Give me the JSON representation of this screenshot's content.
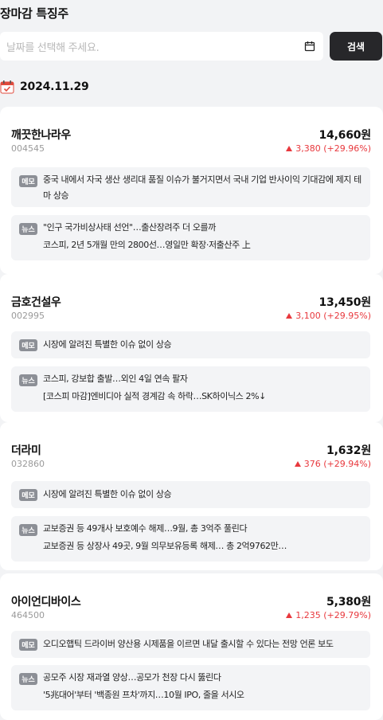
{
  "page": {
    "title": "장마감 특징주"
  },
  "search": {
    "placeholder": "날짜를 선택해 주세요.",
    "button_label": "검색"
  },
  "date_label": "2024.11.29",
  "colors": {
    "accent_up": "#e8383d",
    "button_bg": "#27272a",
    "tag_bg": "#8c8f96"
  },
  "tags": {
    "memo": "메모",
    "news": "뉴스"
  },
  "stocks": [
    {
      "name": "깨끗한나라우",
      "code": "004545",
      "price": "14,660원",
      "change": "3,380 (+29.96%)",
      "memo": "중국 내에서 자국 생산 생리대 품질 이슈가 불거지면서 국내 기업 반사이익 기대감에 제지 테마 상승",
      "news": [
        "\"인구 국가비상사태 선언\"…출산장려주 더 오를까",
        "코스피, 2년 5개월 만의 2800선…영일만 확장·저출산주 上"
      ]
    },
    {
      "name": "금호건설우",
      "code": "002995",
      "price": "13,450원",
      "change": "3,100 (+29.95%)",
      "memo": "시장에 알려진 특별한 이슈 없이 상승",
      "news": [
        "코스피, 강보합 출발…외인 4일 연속 팔자",
        "[코스피 마감]엔비디아 실적 경계감 속 하락…SK하이닉스 2%↓"
      ]
    },
    {
      "name": "더라미",
      "code": "032860",
      "price": "1,632원",
      "change": "376 (+29.94%)",
      "memo": "시장에 알려진 특별한 이슈 없이 상승",
      "news": [
        "교보증권 등 49개사 보호예수 해제…9월, 총 3억주 풀린다",
        "교보증권 등 상장사 49곳, 9월 의무보유등록 해제… 총 2억9762만…"
      ]
    },
    {
      "name": "아이언디바이스",
      "code": "464500",
      "price": "5,380원",
      "change": "1,235 (+29.79%)",
      "memo": "오디오햅틱 드라이버 양산용 시제품을 이르면 내달 출시할 수 있다는 전망 언론 보도",
      "news": [
        "공모주 시장 재과열 양상…공모가 천장 다시 뚫린다",
        "'5兆대어'부터 '백종원 프차'까지…10월 IPO, 줄을 서시오"
      ]
    }
  ]
}
